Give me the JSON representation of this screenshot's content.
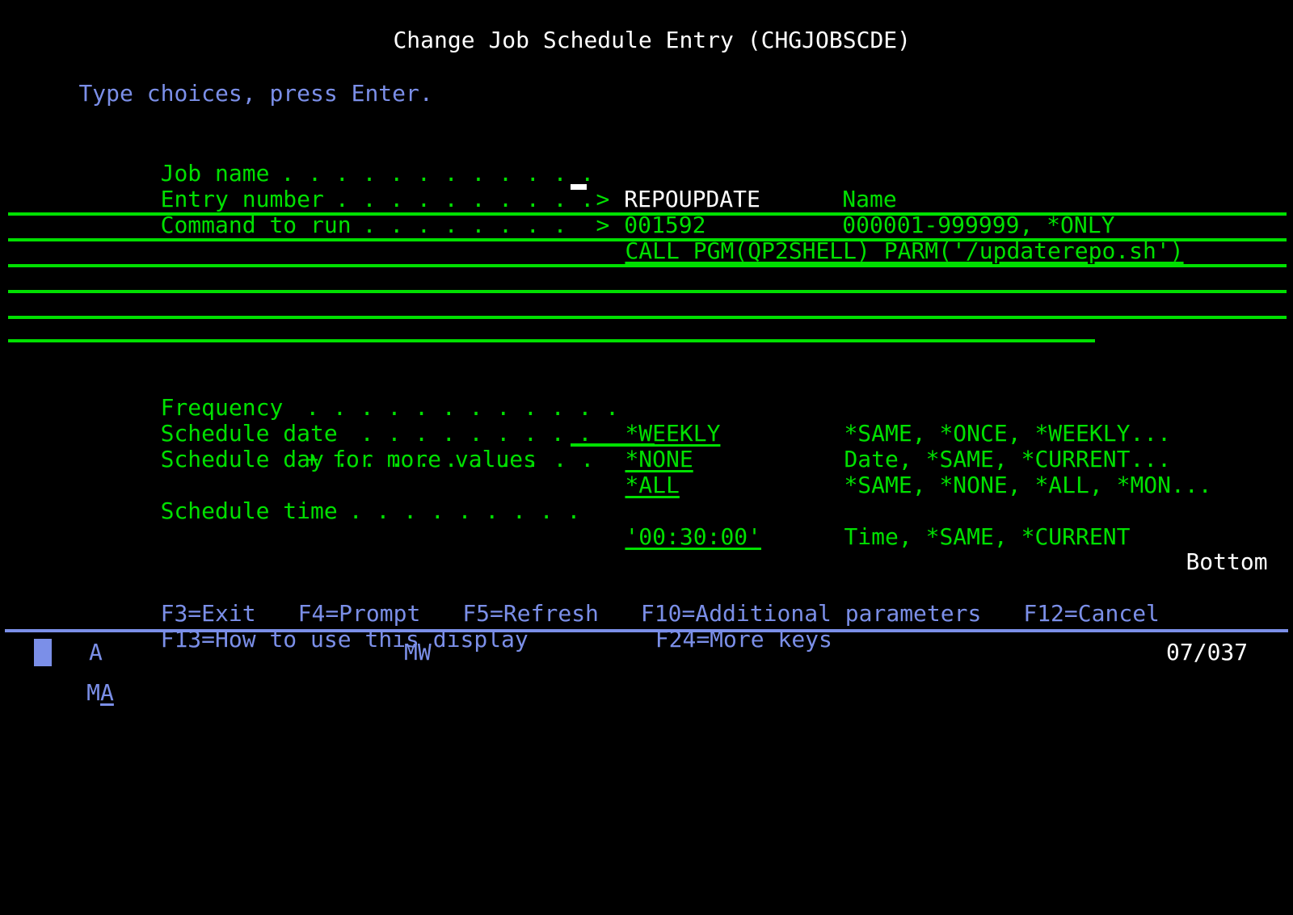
{
  "screen": {
    "title": "Change Job Schedule Entry (CHGJOBSCDE)",
    "instruction": "Type choices, press Enter.",
    "position_indicator": "Bottom"
  },
  "colors": {
    "background": "#000000",
    "green": "#00e000",
    "white": "#ffffff",
    "blue": "#7b8fe8"
  },
  "fields": [
    {
      "label": "Job name",
      "dots": ". . . . . . . . . . . .",
      "prompt_marker": ">",
      "value": "REPOUPDATE",
      "value_color": "white",
      "hint": "Name",
      "underlined": false
    },
    {
      "label": "Entry number",
      "dots": ". . . . . . . . . .",
      "prompt_marker": ">",
      "value": "001592",
      "value_color": "green",
      "hint": "000001-999999, *ONLY",
      "underlined": false
    },
    {
      "label": "Command to run",
      "dots": ". . . . . . . .",
      "prompt_marker": "",
      "value": "CALL PGM(QP2SHELL) PARM('/updaterepo.sh')",
      "value_color": "green",
      "hint": "",
      "underlined": true
    },
    {
      "label": "Frequency",
      "dots": ". . . . . . . . . . . .",
      "prompt_marker": "",
      "value": "*WEEKLY",
      "value_color": "green",
      "hint": "*SAME, *ONCE, *WEEKLY...",
      "underlined": true
    },
    {
      "label": "Schedule date",
      "dots": ". . . . . . . . .",
      "prompt_marker": "",
      "value": "*NONE",
      "value_color": "green",
      "hint": "Date, *SAME, *CURRENT...",
      "underlined": true
    },
    {
      "label": "Schedule day",
      "dots": ". . . . . . . . . .",
      "prompt_marker": "",
      "value": "*ALL",
      "value_color": "green",
      "hint": "*SAME, *NONE, *ALL, *MON...",
      "underlined": true
    },
    {
      "label": "Schedule time",
      "dots": ". . . . . . . . .",
      "prompt_marker": "",
      "value": "'00:30:00'",
      "value_color": "green",
      "hint": "Time, *SAME, *CURRENT",
      "underlined": true
    }
  ],
  "more_values_note": "+ for more values",
  "function_keys": {
    "line1": [
      "F3=Exit",
      "F4=Prompt",
      "F5=Refresh",
      "F10=Additional parameters",
      "F12=Cancel"
    ],
    "line2": [
      "F13=How to use this display",
      "F24=More keys"
    ],
    "line1_text": "F3=Exit   F4=Prompt   F5=Refresh   F10=Additional parameters   F12=Cancel",
    "line2_text": "F13=How to use this display        F24=More keys"
  },
  "status_bar": {
    "system_indicator": "MA",
    "input_inhibited_indicator": "A",
    "mode_indicator": "MW",
    "cursor_position": "07/037"
  }
}
